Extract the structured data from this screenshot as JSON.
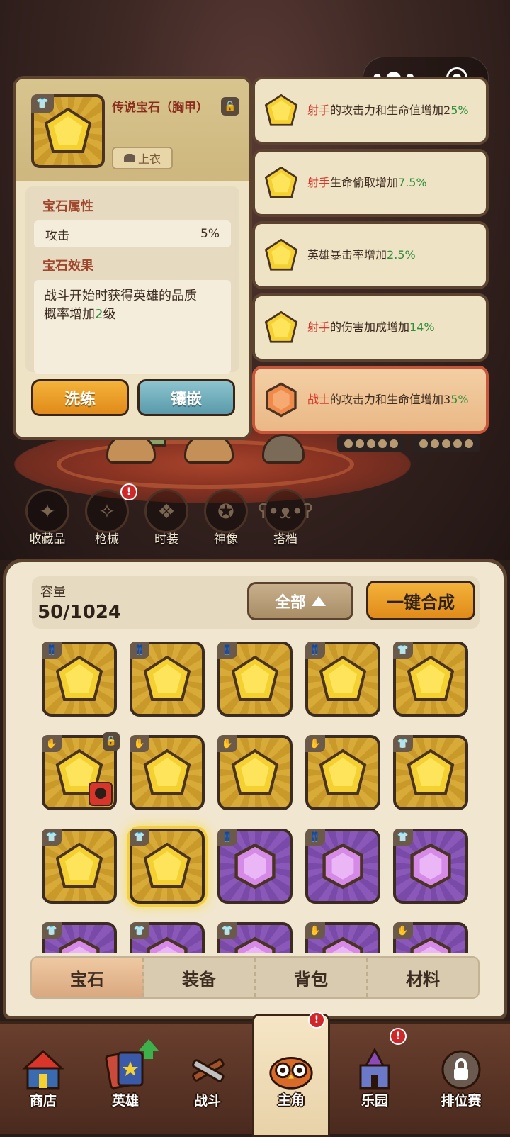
{
  "gem_detail": {
    "title": "传说宝石（胸甲）",
    "slot_tag": "上衣",
    "attr_section": "宝石属性",
    "attr_name": "攻击",
    "attr_value": "5%",
    "effect_section": "宝石效果",
    "effect_line1": "战斗开始时获得英雄的品质",
    "effect_line2_prefix": "概率增加",
    "effect_line2_num": "2",
    "effect_line2_suffix": "级",
    "refine_button": "洗练",
    "inlay_button": "镶嵌"
  },
  "effects": [
    {
      "red": "射手",
      "text": "的攻击力和生命值增加2",
      "green": "5%",
      "gem": "gold"
    },
    {
      "red": "射手",
      "text": "生命偷取增加",
      "green": "7.5%",
      "gem": "gold"
    },
    {
      "red": "",
      "text": "英雄暴击率增加",
      "green": "2.5%",
      "gem": "gold"
    },
    {
      "red": "射手",
      "text": "的伤害加成增加",
      "green": "14%",
      "gem": "gold"
    },
    {
      "red": "战士",
      "text": "的攻击力和生命值增加3",
      "green": "5%",
      "gem": "orange"
    }
  ],
  "categories": [
    "收藏品",
    "枪械",
    "时装",
    "神像",
    "搭档"
  ],
  "inventory": {
    "capacity_label": "容量",
    "capacity_value": "50/1024",
    "filter_label": "全部",
    "merge_button": "一键合成"
  },
  "tabs": [
    "宝石",
    "装备",
    "背包",
    "材料"
  ],
  "nav": [
    "商店",
    "英雄",
    "战斗",
    "主角",
    "乐园",
    "排位赛"
  ],
  "colors": {
    "gold_gem": "#f4d030",
    "purple_gem": "#d68ae8",
    "orange_gem": "#f08a4a",
    "accent_orange": "#e08a1a"
  }
}
